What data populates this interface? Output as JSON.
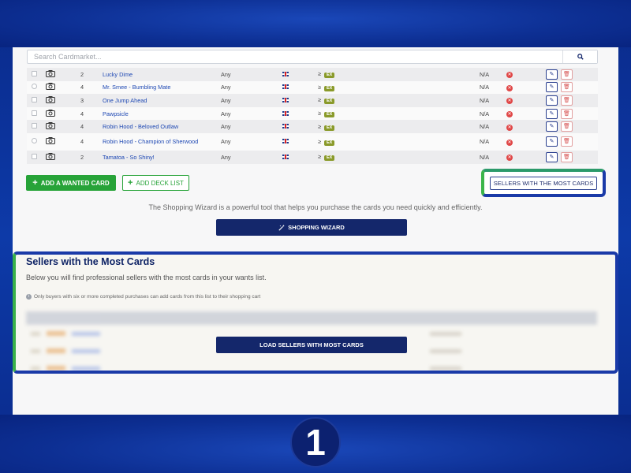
{
  "search": {
    "placeholder": "Search Cardmarket..."
  },
  "wants": {
    "rows": [
      {
        "qty": "2",
        "name": "Lucky Dime",
        "language": "Any",
        "condition": "EX",
        "price": "N/A"
      },
      {
        "qty": "4",
        "name": "Mr. Smee - Bumbling Mate",
        "language": "Any",
        "condition": "EX",
        "price": "N/A"
      },
      {
        "qty": "3",
        "name": "One Jump Ahead",
        "language": "Any",
        "condition": "EX",
        "price": "N/A"
      },
      {
        "qty": "4",
        "name": "Pawpsicle",
        "language": "Any",
        "condition": "EX",
        "price": "N/A"
      },
      {
        "qty": "4",
        "name": "Robin Hood - Beloved Outlaw",
        "language": "Any",
        "condition": "EX",
        "price": "N/A"
      },
      {
        "qty": "4",
        "name": "Robin Hood - Champion of Sherwood",
        "language": "Any",
        "condition": "EX",
        "price": "N/A"
      },
      {
        "qty": "2",
        "name": "Tamatoa - So Shiny!",
        "language": "Any",
        "condition": "EX",
        "price": "N/A"
      }
    ],
    "condition_prefix": "≥"
  },
  "buttons": {
    "add_wanted": "ADD A WANTED CARD",
    "add_deck": "ADD DECK LIST",
    "sellers_most": "SELLERS WITH THE MOST CARDS",
    "shopping_wizard": "SHOPPING WIZARD",
    "load_sellers": "LOAD SELLERS WITH MOST CARDS"
  },
  "wizard_text": "The Shopping Wizard is a powerful tool that helps you purchase the cards you need quickly and efficiently.",
  "sellers": {
    "title": "Sellers with the Most Cards",
    "subtitle": "Below you will find professional sellers with the most cards in your wants list.",
    "note": "Only buyers with six or more completed purchases can add cards from this list to their shopping cart"
  },
  "step": "1",
  "colors": {
    "primary": "#14276b",
    "green": "#27a338",
    "link": "#1e48b3",
    "condition": "#8a9a2a"
  }
}
